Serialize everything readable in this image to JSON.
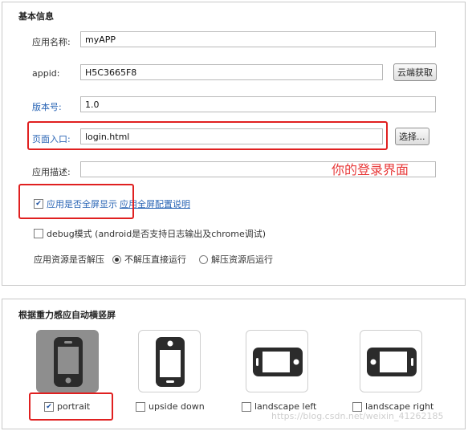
{
  "basic": {
    "title": "基本信息",
    "app_name_label": "应用名称:",
    "app_name_value": "myAPP",
    "appid_label": "appid:",
    "appid_value": "H5C3665F8",
    "appid_button": "云端获取",
    "version_label": "版本号:",
    "version_value": "1.0",
    "entry_label": "页面入口:",
    "entry_value": "login.html",
    "entry_button": "选择...",
    "desc_label": "应用描述:",
    "desc_value": "",
    "annotation": "你的登录界面",
    "fullscreen_label": "应用是否全屏显示",
    "fullscreen_link": "应用全屏配置说明",
    "fullscreen_checked": true,
    "debug_label": "debug模式 (android是否支持日志输出及chrome调试)",
    "debug_checked": false,
    "unzip_label": "应用资源是否解压",
    "unzip_options": [
      "不解压直接运行",
      "解压资源后运行"
    ],
    "unzip_selected": 0
  },
  "orientation": {
    "title": "根据重力感应自动横竖屏",
    "options": [
      {
        "label": "portrait",
        "checked": true
      },
      {
        "label": "upside down",
        "checked": false
      },
      {
        "label": "landscape left",
        "checked": false
      },
      {
        "label": "landscape right",
        "checked": false
      }
    ]
  },
  "watermark": "https://blog.csdn.net/weixin_41262185",
  "colors": {
    "highlight": "#e02020",
    "link": "#2a65b5",
    "annotation": "#e83a3a"
  }
}
